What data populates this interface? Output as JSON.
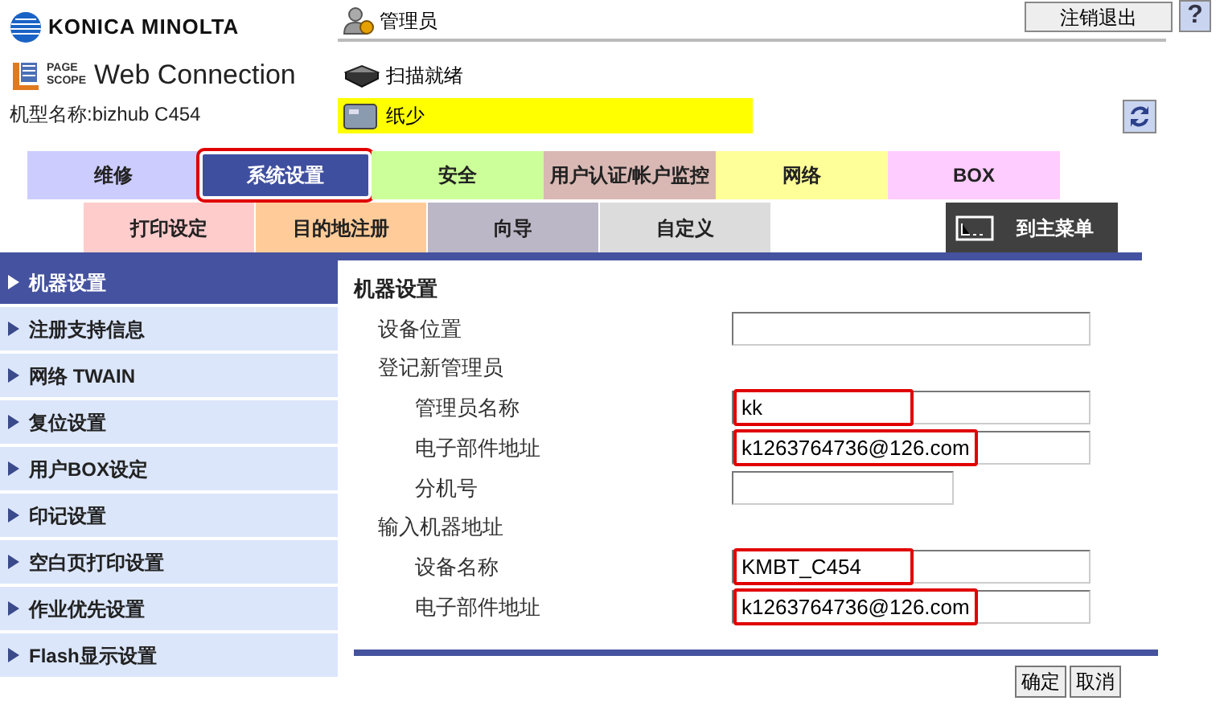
{
  "header": {
    "brand": "KONICA MINOLTA",
    "product_small": [
      "PAGE",
      "SCOPE"
    ],
    "product": "Web Connection",
    "model": "机型名称:bizhub C454",
    "user": "管理员",
    "logout": "注销退出",
    "help": "?",
    "scan_status": "扫描就绪",
    "paper_status": "纸少"
  },
  "tabs": [
    {
      "label": "维修",
      "selected": false,
      "highlighted": false,
      "color": "#ccccff"
    },
    {
      "label": "系统设置",
      "selected": true,
      "highlighted": true,
      "color": "#3f4f9f"
    },
    {
      "label": "安全",
      "selected": false,
      "highlighted": false,
      "color": "#ccff99"
    },
    {
      "label": "用户认证/帐户监控",
      "selected": false,
      "highlighted": false,
      "color": "#d9b8b3"
    },
    {
      "label": "网络",
      "selected": false,
      "highlighted": false,
      "color": "#ffff99"
    },
    {
      "label": "BOX",
      "selected": false,
      "highlighted": false,
      "color": "#ffccff"
    }
  ],
  "subtabs": [
    {
      "label": "打印设定",
      "color": "#ffcccc"
    },
    {
      "label": "目的地注册",
      "color": "#ffcc99"
    },
    {
      "label": "向导",
      "color": "#bcb7c6"
    },
    {
      "label": "自定义",
      "color": "#dcdcdc"
    }
  ],
  "main_menu": "到主菜单",
  "sidebar": {
    "items": [
      {
        "label": "机器设置",
        "selected": true
      },
      {
        "label": "注册支持信息",
        "selected": false
      },
      {
        "label": "网络 TWAIN",
        "selected": false
      },
      {
        "label": "复位设置",
        "selected": false
      },
      {
        "label": "用户BOX设定",
        "selected": false
      },
      {
        "label": "印记设置",
        "selected": false
      },
      {
        "label": "空白页打印设置",
        "selected": false
      },
      {
        "label": "作业优先设置",
        "selected": false
      },
      {
        "label": "Flash显示设置",
        "selected": false
      }
    ]
  },
  "form": {
    "title": "机器设置",
    "rows": [
      {
        "kind": "field",
        "label": "设备位置",
        "highlighted": false
      },
      {
        "kind": "group",
        "label": "登记新管理员",
        "children": [
          {
            "kind": "field",
            "label": "管理员名称",
            "value": "kk",
            "highlighted": true
          },
          {
            "kind": "field",
            "label": "电子部件地址",
            "value": "k1263764736@126.com",
            "highlighted": true
          },
          {
            "kind": "short_field",
            "label": "分机号",
            "highlighted": false
          }
        ]
      },
      {
        "kind": "group",
        "label": "输入机器地址",
        "children": [
          {
            "kind": "field",
            "label": "设备名称",
            "value": "KMBT_C454",
            "highlighted": true
          },
          {
            "kind": "field",
            "label": "电子部件地址",
            "value": "k1263764736@126.com",
            "highlighted": true
          }
        ]
      }
    ],
    "buttons": [
      "确定",
      "取消"
    ]
  }
}
